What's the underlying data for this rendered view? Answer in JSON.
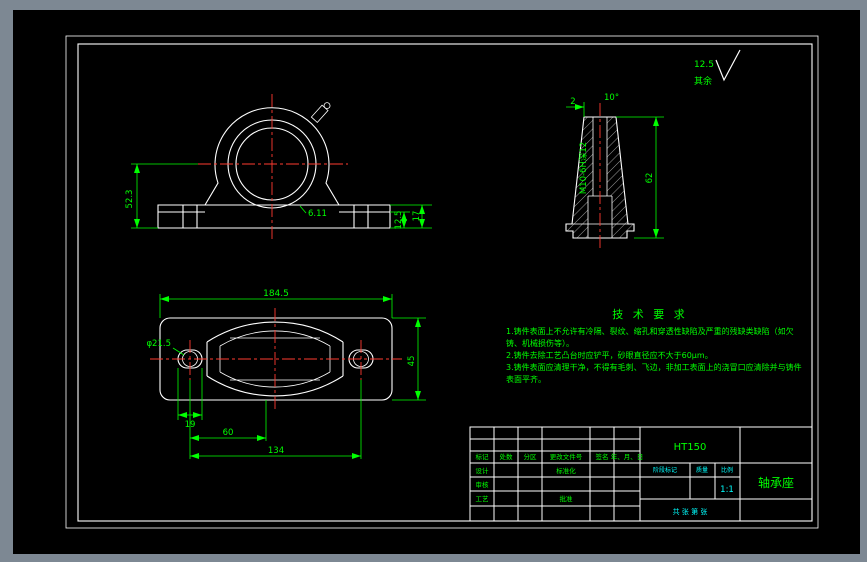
{
  "colors": {
    "background": "#000000",
    "window_frame": "#7d8893",
    "object_line": "#ffffff",
    "dimension": "#00ff00",
    "centerline": "#ff3b30",
    "accent_cyan": "#00ffff"
  },
  "roughness": {
    "value": "12.5",
    "label": "其余"
  },
  "front_view": {
    "height": "52.3",
    "step": "12.5",
    "base": "17",
    "note": "6.11"
  },
  "side_view": {
    "offset": "2",
    "angle": "10°",
    "height": "62",
    "thread": "M10-6H深12"
  },
  "top_view": {
    "overall": "184.5",
    "slot_hole": "φ21.5",
    "slot_width": "19",
    "inner_span": "60",
    "bolt_span": "134",
    "width": "45"
  },
  "tech_req": {
    "title": "技 术 要 求",
    "lines": [
      "1.铸件表面上不允许有冷隔、裂纹、缩孔和穿透性缺陷及严重的残缺类缺陷（如欠",
      "  铸、机械损伤等）。",
      "2.铸件去除工艺凸台时应铲平，砂眼直径应不大于60μm。",
      "3.铸件表面应清理干净，不得有毛刺、飞边，非加工表面上的浇冒口应清除并与铸件",
      "  表面平齐。"
    ]
  },
  "title_block": {
    "material": "HT150",
    "part_name": "轴承座",
    "rev_headers": [
      "标记",
      "处数",
      "分区",
      "更改文件号",
      "签名",
      "年、月、日"
    ],
    "sign_rows": [
      "设计",
      "审核",
      "工艺"
    ],
    "right_labels": [
      "标准化",
      "批准"
    ],
    "info_headers": [
      "阶段标记",
      "质量",
      "比例"
    ],
    "scale": "1:1",
    "sheet": "共 张 第 张"
  }
}
